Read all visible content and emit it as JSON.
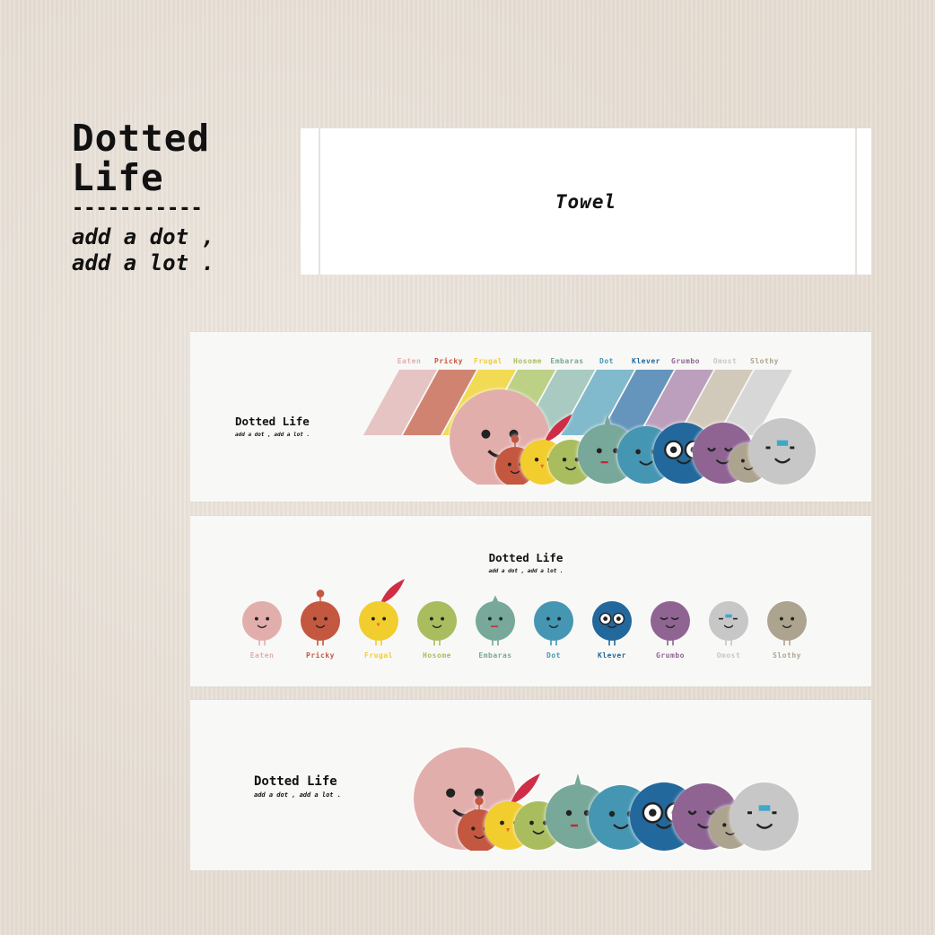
{
  "brand": {
    "title_line1": "Dotted",
    "title_line2": "Life",
    "rule": "-----------",
    "tagline_line1": "add a dot ,",
    "tagline_line2": "add a lot ."
  },
  "product_tag": {
    "label": "Towel"
  },
  "panels": [
    {
      "title": "Dotted Life",
      "subtitle": "add a dot , add a lot ."
    },
    {
      "title": "Dotted Life",
      "subtitle": "add a dot , add a lot ."
    },
    {
      "title": "Dotted Life",
      "subtitle": "add a dot , add a lot ."
    }
  ],
  "characters": [
    {
      "name": "Eaten",
      "color": "#e2aeac"
    },
    {
      "name": "Pricky",
      "color": "#c4573f"
    },
    {
      "name": "Frugal",
      "color": "#f2cd2e"
    },
    {
      "name": "Hosome",
      "color": "#a9bd5f"
    },
    {
      "name": "Embaras",
      "color": "#77a89a"
    },
    {
      "name": "Dot",
      "color": "#4596b3"
    },
    {
      "name": "Klever",
      "color": "#23689c"
    },
    {
      "name": "Grumbo",
      "color": "#8f6493"
    },
    {
      "name": "Omost",
      "color": "#c7c7c7"
    },
    {
      "name": "Slothy",
      "color": "#ada490"
    }
  ],
  "lineup_order": [
    "Eaten",
    "Pricky",
    "Frugal",
    "Hosome",
    "Embaras",
    "Dot",
    "Klever",
    "Grumbo",
    "Slothy",
    "Omost"
  ],
  "colors": {
    "background": "#e6ddd3",
    "panel": "#f8f8f7",
    "text": "#111111",
    "feather": "#cf2d46",
    "stripes": [
      "#e4c1c0",
      "#cf7c6a",
      "#f0d84b",
      "#b8cd7f",
      "#a3c7be",
      "#7ab6c9",
      "#5d8fb8",
      "#b79ab9",
      "#cfc7b7",
      "#d5d5d5"
    ]
  },
  "icons": [
    "feather-icon",
    "antenna-icon",
    "spike-icon",
    "eye-icon",
    "bandage-icon"
  ]
}
